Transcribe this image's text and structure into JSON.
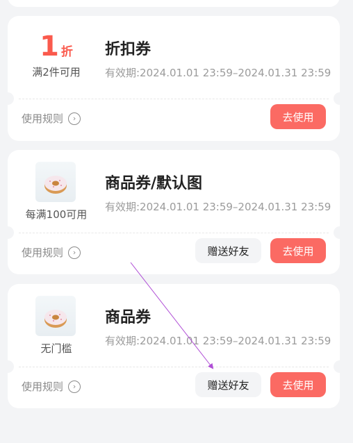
{
  "coupons": [
    {
      "discount_number": "1",
      "discount_unit": "折",
      "condition": "满2件可用",
      "title": "折扣券",
      "validity": "有效期:2024.01.01 23:59–2024.01.31 23:59",
      "rules_label": "使用规则",
      "use_label": "去使用"
    },
    {
      "condition": "每满100可用",
      "title": "商品券/默认图",
      "validity": "有效期:2024.01.01 23:59–2024.01.31 23:59",
      "rules_label": "使用规则",
      "gift_label": "赠送好友",
      "use_label": "去使用"
    },
    {
      "condition": "无门槛",
      "title": "商品券",
      "validity": "有效期:2024.01.01 23:59–2024.01.31 23:59",
      "rules_label": "使用规则",
      "gift_label": "赠送好友",
      "use_label": "去使用"
    }
  ],
  "colors": {
    "accent": "#fb6a63",
    "discount_text": "#fa5a4d",
    "background": "#f3f4f6"
  }
}
